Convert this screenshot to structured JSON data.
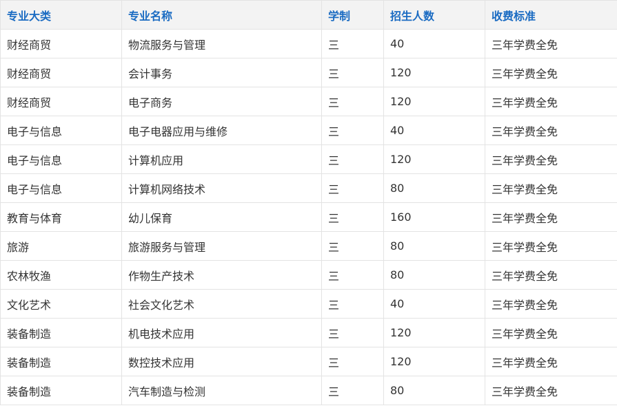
{
  "table": {
    "headers": [
      "专业大类",
      "专业名称",
      "学制",
      "招生人数",
      "收费标准"
    ],
    "rows": [
      [
        "财经商贸",
        "物流服务与管理",
        "三",
        "40",
        "三年学费全免"
      ],
      [
        "财经商贸",
        "会计事务",
        "三",
        "120",
        "三年学费全免"
      ],
      [
        "财经商贸",
        "电子商务",
        "三",
        "120",
        "三年学费全免"
      ],
      [
        "电子与信息",
        "电子电器应用与维修",
        "三",
        "40",
        "三年学费全免"
      ],
      [
        "电子与信息",
        "计算机应用",
        "三",
        "120",
        "三年学费全免"
      ],
      [
        "电子与信息",
        "计算机网络技术",
        "三",
        "80",
        "三年学费全免"
      ],
      [
        "教育与体育",
        "幼儿保育",
        "三",
        "160",
        "三年学费全免"
      ],
      [
        "旅游",
        "旅游服务与管理",
        "三",
        "80",
        "三年学费全免"
      ],
      [
        "农林牧渔",
        "作物生产技术",
        "三",
        "80",
        "三年学费全免"
      ],
      [
        "文化艺术",
        "社会文化艺术",
        "三",
        "40",
        "三年学费全免"
      ],
      [
        "装备制造",
        "机电技术应用",
        "三",
        "120",
        "三年学费全免"
      ],
      [
        "装备制造",
        "数控技术应用",
        "三",
        "120",
        "三年学费全免"
      ],
      [
        "装备制造",
        "汽车制造与检测",
        "三",
        "80",
        "三年学费全免"
      ]
    ]
  },
  "colors": {
    "header_text": "#1a6bc2",
    "header_bg": "#f3f3f3",
    "cell_text": "#333333",
    "border": "#e3e3e3"
  }
}
